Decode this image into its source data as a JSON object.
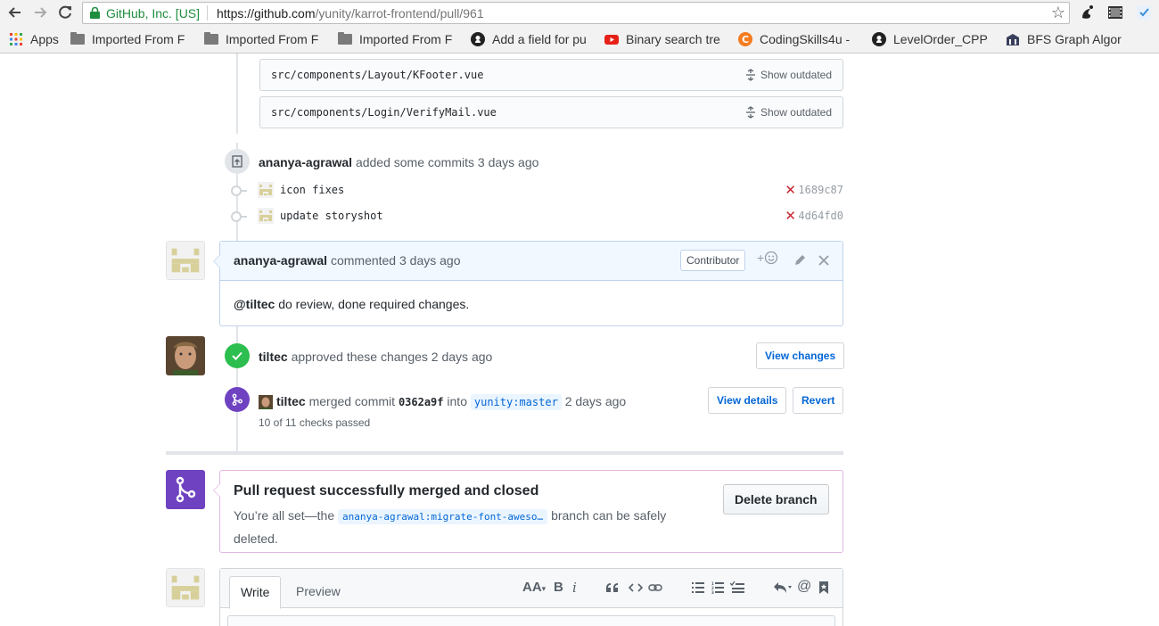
{
  "browser": {
    "secure_label": "GitHub, Inc. [US]",
    "url_scheme_host": "https://github.com",
    "url_path": "/yunity/karrot-frontend/pull/961",
    "bookmarks": [
      {
        "label": "Apps",
        "icon": "apps-grid-icon"
      },
      {
        "label": "Imported From F",
        "icon": "folder-icon"
      },
      {
        "label": "Imported From F",
        "icon": "folder-icon"
      },
      {
        "label": "Imported From F",
        "icon": "folder-icon"
      },
      {
        "label": "Add a field for pu",
        "icon": "github-icon"
      },
      {
        "label": "Binary search tre",
        "icon": "youtube-icon"
      },
      {
        "label": "CodingSkills4u -",
        "icon": "codingskills-icon"
      },
      {
        "label": "LevelOrder_CPP",
        "icon": "github-icon"
      },
      {
        "label": "BFS Graph Algor",
        "icon": "bfs-icon"
      }
    ]
  },
  "outdated_files": [
    {
      "path": "src/components/Layout/KFooter.vue",
      "action": "Show outdated"
    },
    {
      "path": "src/components/Login/VerifyMail.vue",
      "action": "Show outdated"
    }
  ],
  "commits_event": {
    "author": "ananya-agrawal",
    "text": "added some commits 3 days ago",
    "commits": [
      {
        "message": "icon fixes",
        "sha": "1689c87"
      },
      {
        "message": "update storyshot",
        "sha": "4d64fd0"
      }
    ]
  },
  "comment": {
    "author": "ananya-agrawal",
    "meta": "commented 3 days ago",
    "role": "Contributor",
    "reaction_plus": "+",
    "mention": "@tiltec",
    "body": " do review, done required changes."
  },
  "approval": {
    "author": "tiltec",
    "text": "approved these changes 2 days ago",
    "button": "View changes"
  },
  "merge_event": {
    "author": "tiltec",
    "text": "merged commit",
    "commit": "0362a9f",
    "into": "into",
    "branch": "yunity:master",
    "when": "2 days ago",
    "checks": "10 of 11 checks passed",
    "view_details": "View details",
    "revert": "Revert"
  },
  "merged_box": {
    "title": "Pull request successfully merged and closed",
    "desc_before": "You’re all set—the",
    "branch": "ananya-agrawal:migrate-font-aweso…",
    "desc_after": "branch can be safely deleted.",
    "button": "Delete branch"
  },
  "editor": {
    "tab_write": "Write",
    "tab_preview": "Preview",
    "tool_heading": "AA",
    "tool_bold": "B",
    "tool_italic": "i",
    "tool_mention": "@"
  },
  "colors": {
    "approved": "#2cbe4e",
    "merged": "#6f42c1",
    "fail": "#cb2431",
    "link": "#0366d6"
  }
}
